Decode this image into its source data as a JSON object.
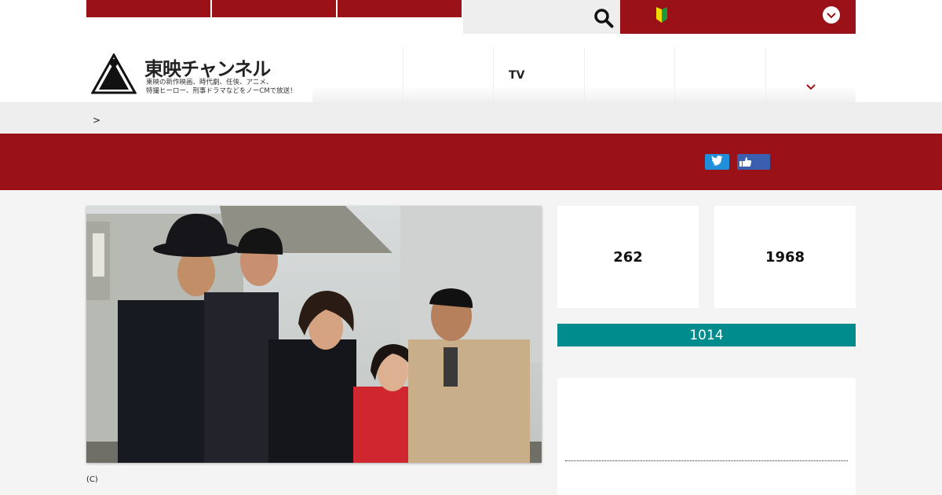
{
  "header": {
    "top_tabs": [
      "",
      "",
      ""
    ],
    "search": {
      "placeholder": ""
    },
    "logo": {
      "title": "東映チャンネル",
      "tagline_1": "東映の新作映画、時代劇、任侠、アニメ、",
      "tagline_2": "特撮ヒーロー、刑事ドラマなどをノーCMで放送！"
    },
    "nav": [
      {
        "label": "　　　　　　"
      },
      {
        "label": "　　　　　　"
      },
      {
        "label": "TV　　　　"
      },
      {
        "label": "　　　"
      },
      {
        "label": "　　　　"
      },
      {
        "label": "　　　　"
      }
    ]
  },
  "breadcrumb": {
    "separator": ">"
  },
  "title_band": {
    "title": ""
  },
  "main": {
    "photo_caption": "(C)",
    "stats": {
      "episodes": "262",
      "year": "1968"
    },
    "program_code": "1014"
  },
  "colors": {
    "brand_red": "#9a1218",
    "teal": "#008c8c",
    "twitter": "#1e8fd8",
    "facebook": "#3b5fae"
  }
}
